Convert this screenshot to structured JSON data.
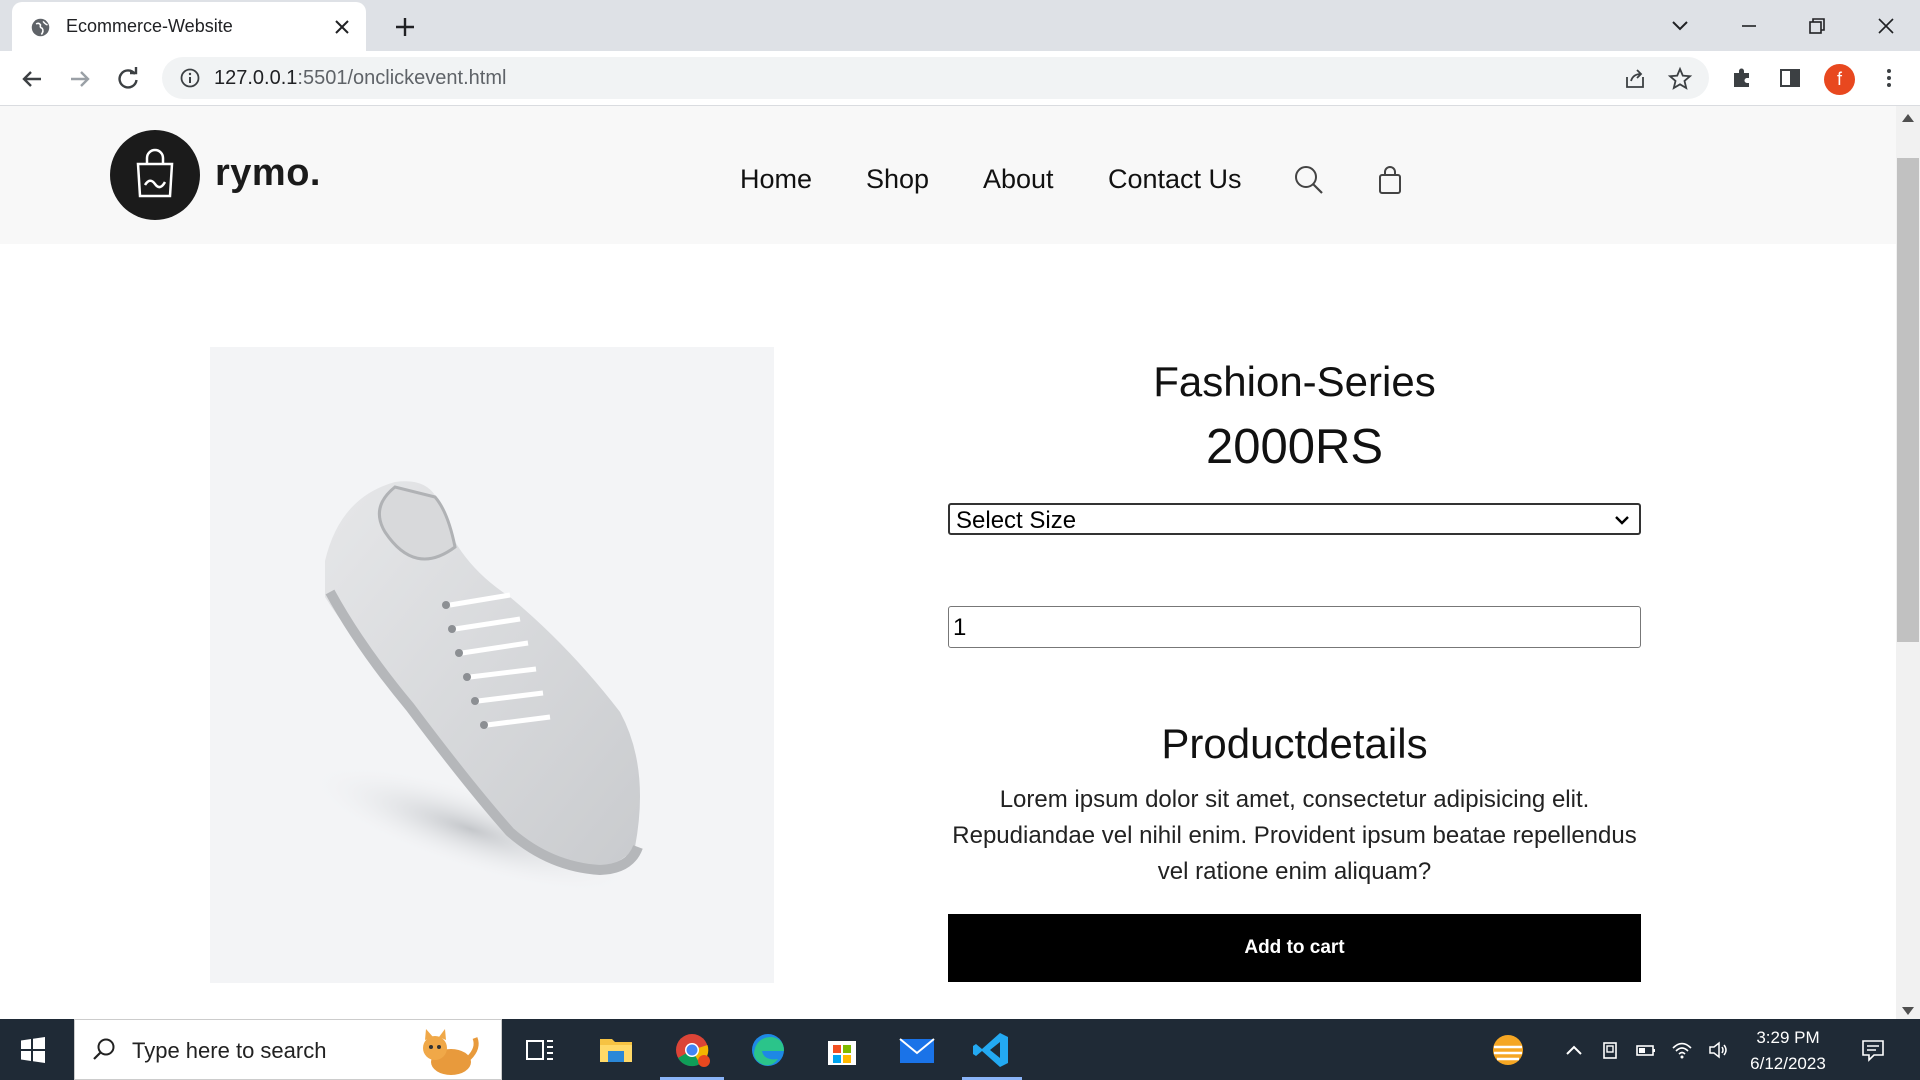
{
  "browser": {
    "tab_title": "Ecommerce-Website",
    "url_host": "127.0.0.1",
    "url_rest": ":5501/onclickevent.html",
    "profile_initial": "f"
  },
  "site": {
    "logo_text": "rymo.",
    "nav": [
      "Home",
      "Shop",
      "About",
      "Contact Us"
    ]
  },
  "product": {
    "title": "Fashion-Series",
    "price": "2000RS",
    "size_select": "Select Size",
    "quantity": "1",
    "details_heading": "Productdetails",
    "details_text": "Lorem ipsum dolor sit amet, consectetur adipisicing elit. Repudiandae vel nihil enim. Provident ipsum beatae repellendus vel ratione enim aliquam?",
    "add_to_cart": "Add to cart"
  },
  "taskbar": {
    "search_placeholder": "Type here to search",
    "time": "3:29 PM",
    "date": "6/12/2023"
  },
  "colors": {
    "tabstrip": "#dee1e6",
    "header_bg": "#f8f8f8",
    "button_bg": "#000000",
    "taskbar_bg": "#1f2a36",
    "avatar": "#e8481f"
  }
}
